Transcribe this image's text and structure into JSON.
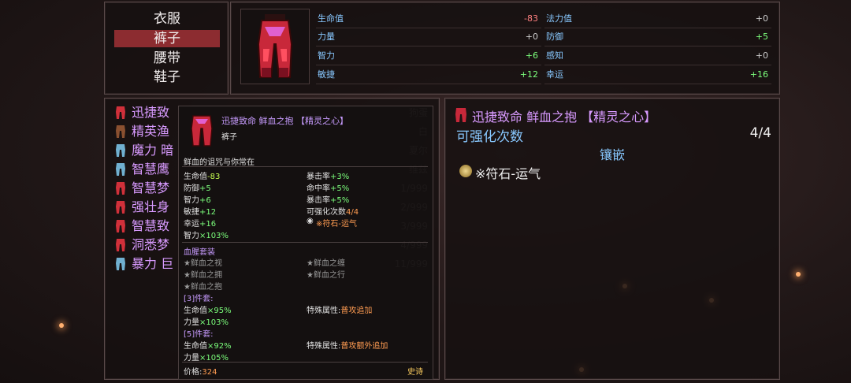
{
  "categories": [
    "衣服",
    "裤子",
    "腰带",
    "鞋子"
  ],
  "selected_category": "裤子",
  "stats": [
    {
      "name": "生命值",
      "value": "-83",
      "color": "red"
    },
    {
      "name": "法力值",
      "value": "+0",
      "color": "white"
    },
    {
      "name": "力量",
      "value": "+0",
      "color": "white"
    },
    {
      "name": "防御",
      "value": "+5",
      "color": "green"
    },
    {
      "name": "智力",
      "value": "+6",
      "color": "green"
    },
    {
      "name": "感知",
      "value": "+0",
      "color": "white"
    },
    {
      "name": "敏捷",
      "value": "+12",
      "color": "green"
    },
    {
      "name": "幸运",
      "value": "+16",
      "color": "green"
    }
  ],
  "item_list": [
    {
      "name": "迅捷致",
      "right": "狗蛋",
      "icon_color": "#d0303a"
    },
    {
      "name": "精英渔",
      "right": "白",
      "icon_color": "#8a5030"
    },
    {
      "name": "魔力 暗",
      "right": "夏尔",
      "icon_color": "#70b0d0"
    },
    {
      "name": "智慧鹰",
      "right": "维兹",
      "icon_color": "#70b0d0"
    },
    {
      "name": "智慧梦",
      "right": "1/999",
      "icon_color": "#d0303a"
    },
    {
      "name": "强壮身",
      "right": "2/999",
      "icon_color": "#d0303a"
    },
    {
      "name": "智慧致",
      "right": "3/999",
      "icon_color": "#d0303a"
    },
    {
      "name": "洞悉梦",
      "right": "4/999",
      "icon_color": "#d0303a"
    },
    {
      "name": "暴力 巨",
      "right": "11/999",
      "icon_color": "#70b0d0"
    }
  ],
  "detail": {
    "title": "迅捷致命 鲜血之抱 【精灵之心】",
    "enhance_label": "可强化次数",
    "enhance_value": "4/4",
    "inlay_label": "镶嵌",
    "gem": "※符石-运气"
  },
  "tooltip": {
    "title": "迅捷致命 鲜血之抱 【精灵之心】",
    "type": "裤子",
    "flavor": "鲜血的诅咒与你常在",
    "stats_left": [
      {
        "label": "生命值",
        "value": "-83",
        "color": "lime"
      },
      {
        "label": "防御",
        "value": "+5",
        "color": "green"
      },
      {
        "label": "智力",
        "value": "+6",
        "color": "green"
      },
      {
        "label": "敏捷",
        "value": "+12",
        "color": "green"
      },
      {
        "label": "幸运",
        "value": "+16",
        "color": "green"
      },
      {
        "label": "智力",
        "value": "×103%",
        "color": "green"
      }
    ],
    "stats_right": [
      {
        "label": "暴击率",
        "value": "+3%",
        "color": "green"
      },
      {
        "label": "命中率",
        "value": "+5%",
        "color": "green"
      },
      {
        "label": "暴击率",
        "value": "+5%",
        "color": "green"
      },
      {
        "label": "可强化次数",
        "value": "4/4",
        "color": "orange"
      }
    ],
    "gem": "※符石-运气",
    "set_name": "血腥套装",
    "set_items": [
      "★鲜血之视",
      "★鲜血之缠",
      "★鲜血之拥",
      "★鲜血之行",
      "★鲜血之抱"
    ],
    "set3_label": "[3]件套:",
    "set3_stats": [
      {
        "label": "生命值",
        "value": "×95%"
      },
      {
        "label": "力量",
        "value": "×103%"
      }
    ],
    "set3_special_label": "特殊属性:",
    "set3_special": "普攻追加",
    "set5_label": "[5]件套:",
    "set5_stats": [
      {
        "label": "生命值",
        "value": "×92%"
      },
      {
        "label": "力量",
        "value": "×105%"
      }
    ],
    "set5_special_label": "特殊属性:",
    "set5_special": "普攻额外追加",
    "price_label": "价格:",
    "price": "324",
    "rarity": "史诗"
  },
  "colors": {
    "accent": "#8c2c30",
    "stat_label": "#88c8ff",
    "item_name": "#d89aff"
  }
}
